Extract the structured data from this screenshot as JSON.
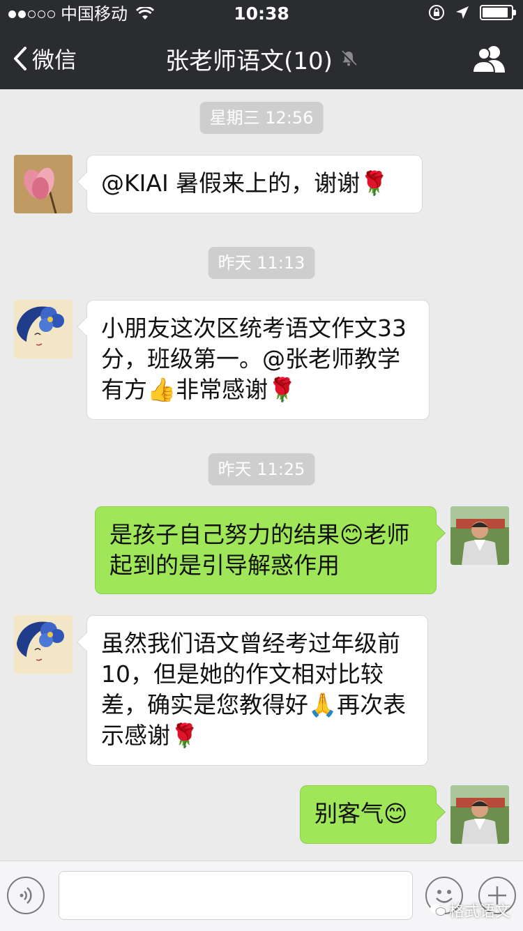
{
  "status_bar": {
    "carrier": "中国移动",
    "time": "10:38",
    "signal_dots_filled": 2,
    "signal_dots_total": 5,
    "battery_level": 0.9
  },
  "nav": {
    "back_label": "微信",
    "title": "张老师语文(10)",
    "muted": true,
    "right_icon": "group-members-icon"
  },
  "messages": [
    {
      "type": "time",
      "text": "星期三 12:56"
    },
    {
      "type": "msg",
      "side": "in",
      "avatar": "magnolia-avatar",
      "text": "@KIAI 暑假来上的，谢谢🌹"
    },
    {
      "type": "time",
      "text": "昨天 11:13"
    },
    {
      "type": "msg",
      "side": "in",
      "avatar": "blue-flower-avatar",
      "text": "小朋友这次区统考语文作文33分，班级第一。@张老师教学有方👍非常感谢🌹"
    },
    {
      "type": "time",
      "text": "昨天 11:25"
    },
    {
      "type": "msg",
      "side": "out",
      "avatar": "teacher-photo-avatar",
      "text": "是孩子自己努力的结果😊老师起到的是引导解惑作用"
    },
    {
      "type": "msg",
      "side": "in",
      "avatar": "blue-flower-avatar",
      "text": "虽然我们语文曾经考过年级前10，但是她的作文相对比较差，确实是您教得好🙏再次表示感谢🌹"
    },
    {
      "type": "msg",
      "side": "out",
      "avatar": "teacher-photo-avatar",
      "text": "别客气😊"
    }
  ],
  "input_bar": {
    "voice_icon": "voice-icon",
    "emoji_icon": "emoji-icon",
    "plus_icon": "plus-icon",
    "input_value": ""
  },
  "watermark": "格式语文",
  "colors": {
    "bar_background": "#2b2c30",
    "chat_background": "#ebebeb",
    "outgoing_bubble": "#9fe659",
    "incoming_bubble": "#ffffff",
    "time_chip": "#cecece"
  }
}
